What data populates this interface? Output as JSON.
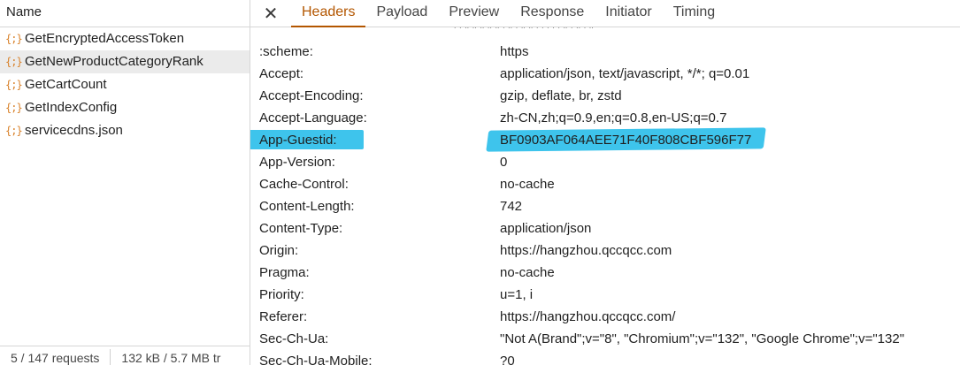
{
  "request_list": {
    "column_header": "Name",
    "items": [
      {
        "name": "GetEncryptedAccessToken",
        "icon": "json-braces-icon",
        "selected": false
      },
      {
        "name": "GetNewProductCategoryRank",
        "icon": "json-braces-icon",
        "selected": true
      },
      {
        "name": "GetCartCount",
        "icon": "json-braces-icon",
        "selected": false
      },
      {
        "name": "GetIndexConfig",
        "icon": "json-braces-icon",
        "selected": false
      },
      {
        "name": "servicecdns.json",
        "icon": "json-braces-icon",
        "selected": false
      }
    ],
    "icon_glyph": "{;}",
    "status": {
      "requests": "5 / 147 requests",
      "transferred": "132 kB / 5.7 MB tr"
    }
  },
  "tabs": {
    "close_glyph": "✕",
    "items": [
      "Headers",
      "Payload",
      "Preview",
      "Response",
      "Initiator",
      "Timing"
    ],
    "active": "Headers"
  },
  "headers": {
    "cut_row": {
      "name": "",
      "value": "' ' '' '' '' '' '' ' '' ' '' '' ' ' ' ' ' '' ' '' ' ''"
    },
    "rows": [
      {
        "name": ":scheme:",
        "value": "https"
      },
      {
        "name": "Accept:",
        "value": "application/json, text/javascript, */*; q=0.01"
      },
      {
        "name": "Accept-Encoding:",
        "value": "gzip, deflate, br, zstd"
      },
      {
        "name": "Accept-Language:",
        "value": "zh-CN,zh;q=0.9,en;q=0.8,en-US;q=0.7"
      },
      {
        "name": "App-Guestid:",
        "value": "BF0903AF064AEE71F40F808CBF596F77",
        "highlighted": true
      },
      {
        "name": "App-Version:",
        "value": "0"
      },
      {
        "name": "Cache-Control:",
        "value": "no-cache"
      },
      {
        "name": "Content-Length:",
        "value": "742"
      },
      {
        "name": "Content-Type:",
        "value": "application/json"
      },
      {
        "name": "Origin:",
        "value": "https://hangzhou.qccqcc.com"
      },
      {
        "name": "Pragma:",
        "value": "no-cache"
      },
      {
        "name": "Priority:",
        "value": "u=1, i"
      },
      {
        "name": "Referer:",
        "value": "https://hangzhou.qccqcc.com/"
      },
      {
        "name": "Sec-Ch-Ua:",
        "value": "\"Not A(Brand\";v=\"8\", \"Chromium\";v=\"132\", \"Google Chrome\";v=\"132\""
      },
      {
        "name": "Sec-Ch-Ua-Mobile:",
        "value": "?0"
      }
    ]
  },
  "colors": {
    "active_tab": "#b35600",
    "highlight": "#3ec4ec",
    "json_icon": "#d9822b"
  }
}
